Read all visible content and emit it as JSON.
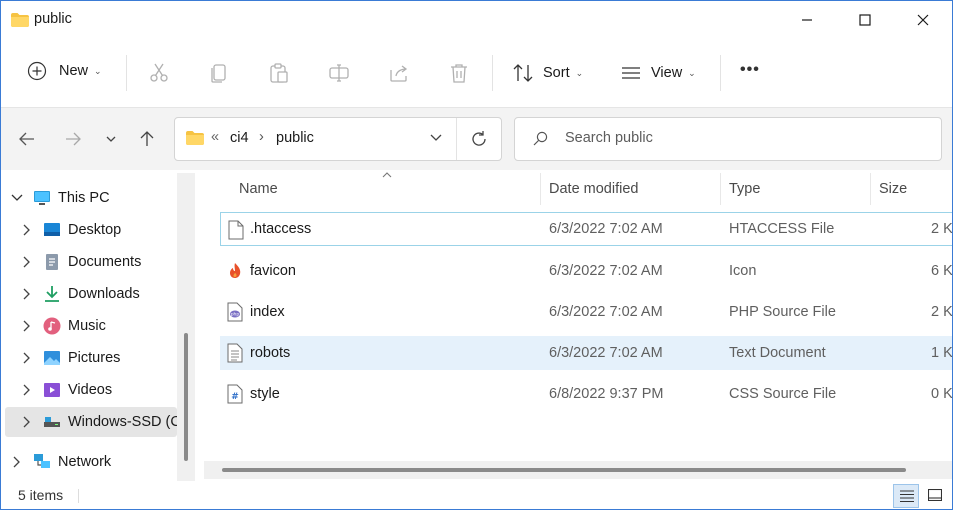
{
  "window": {
    "title": "public",
    "minimize_glyph": "—",
    "maximize_glyph": "☐",
    "close_glyph": "✕"
  },
  "toolbar": {
    "new_label": "New",
    "sort_label": "Sort",
    "view_label": "View",
    "more_label": "•••",
    "icons": [
      "cut-icon",
      "copy-icon",
      "paste-icon",
      "rename-icon",
      "share-icon",
      "delete-icon"
    ]
  },
  "address": {
    "overflow": "«",
    "crumbs": [
      "ci4",
      "public"
    ],
    "separator": "›",
    "search_placeholder": "Search public"
  },
  "nav": {
    "items": [
      {
        "label": "This PC",
        "icon": "monitor-icon",
        "expanded": true
      },
      {
        "label": "Desktop",
        "icon": "desktop-icon"
      },
      {
        "label": "Documents",
        "icon": "documents-icon"
      },
      {
        "label": "Downloads",
        "icon": "downloads-icon"
      },
      {
        "label": "Music",
        "icon": "music-icon"
      },
      {
        "label": "Pictures",
        "icon": "pictures-icon"
      },
      {
        "label": "Videos",
        "icon": "videos-icon"
      },
      {
        "label": "Windows-SSD (C",
        "icon": "drive-icon",
        "selected": true
      },
      {
        "label": "Network",
        "icon": "network-icon"
      }
    ]
  },
  "files": {
    "columns": [
      "Name",
      "Date modified",
      "Type",
      "Size"
    ],
    "rows": [
      {
        "name": ".htaccess",
        "date": "6/3/2022 7:02 AM",
        "type": "HTACCESS File",
        "size": "2 K",
        "icon": "file-icon"
      },
      {
        "name": "favicon",
        "date": "6/3/2022 7:02 AM",
        "type": "Icon",
        "size": "6 K",
        "icon": "flame-icon"
      },
      {
        "name": "index",
        "date": "6/3/2022 7:02 AM",
        "type": "PHP Source File",
        "size": "2 K",
        "icon": "php-icon"
      },
      {
        "name": "robots",
        "date": "6/3/2022 7:02 AM",
        "type": "Text Document",
        "size": "1 K",
        "icon": "text-file-icon"
      },
      {
        "name": "style",
        "date": "6/8/2022 9:37 PM",
        "type": "CSS Source File",
        "size": "0 K",
        "icon": "css-file-icon"
      }
    ]
  },
  "status": {
    "item_count": "5 items"
  },
  "colors": {
    "accent": "#0067c0",
    "folder": "#f6c343",
    "hover_row": "#e5f1fb"
  }
}
